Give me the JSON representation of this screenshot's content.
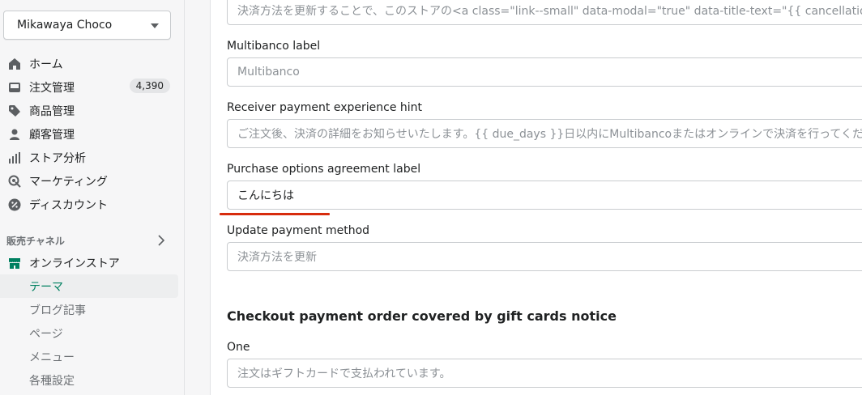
{
  "store": {
    "name": "Mikawaya Choco"
  },
  "nav": {
    "items": [
      {
        "label": "ホーム",
        "icon": "home-icon"
      },
      {
        "label": "注文管理",
        "icon": "orders-icon",
        "badge": "4,390"
      },
      {
        "label": "商品管理",
        "icon": "tag-icon"
      },
      {
        "label": "顧客管理",
        "icon": "customer-icon"
      },
      {
        "label": "ストア分析",
        "icon": "analytics-icon"
      },
      {
        "label": "マーケティング",
        "icon": "marketing-icon"
      },
      {
        "label": "ディスカウント",
        "icon": "discount-icon"
      }
    ]
  },
  "sales_channels": {
    "label": "販売チャネル",
    "online_store": "オンラインストア",
    "sub_items": [
      "テーマ",
      "ブログ記事",
      "ページ",
      "メニュー",
      "各種設定"
    ]
  },
  "form": {
    "top_field_value": "決済方法を更新することで、このストアの<a class=\"link--small\" data-modal=\"true\" data-title-text=\"{{ cancellation_policy",
    "multibanco_label": "Multibanco label",
    "multibanco_placeholder": "Multibanco",
    "receiver_hint_label": "Receiver payment experience hint",
    "receiver_hint_placeholder": "ご注文後、決済の詳細をお知らせいたします。{{ due_days }}日以内にMultibancoまたはオンラインで決済を行ってください",
    "purchase_options_label": "Purchase options agreement label",
    "purchase_options_value": "こんにちは",
    "update_payment_label": "Update payment method",
    "update_payment_placeholder": "決済方法を更新",
    "section_heading": "Checkout payment order covered by gift cards notice",
    "one_label": "One",
    "one_placeholder": "注文はギフトカードで支払われています。"
  },
  "colors": {
    "accent": "#008060",
    "highlight_underline": "#d72c0d"
  }
}
